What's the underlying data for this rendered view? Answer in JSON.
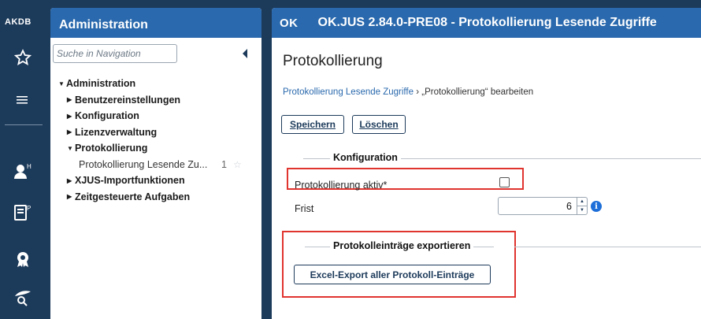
{
  "rail": {
    "logo": "AKDB",
    "icons": [
      "star-icon",
      "menu-icon",
      "user-h-icon",
      "form-p-icon",
      "badge-icon",
      "search-hand-icon"
    ]
  },
  "nav": {
    "header": "Administration",
    "search_placeholder": "Suche in Navigation",
    "tree": [
      {
        "label": "Administration",
        "level": 0,
        "caret": "▼"
      },
      {
        "label": "Benutzereinstellungen",
        "level": 1,
        "caret": "▶"
      },
      {
        "label": "Konfiguration",
        "level": 1,
        "caret": "▶"
      },
      {
        "label": "Lizenzverwaltung",
        "level": 1,
        "caret": "▶"
      },
      {
        "label": "Protokollierung",
        "level": 1,
        "caret": "▼"
      },
      {
        "label": "Protokollierung Lesende Zu...",
        "level": 2,
        "badge": "1"
      },
      {
        "label": "XJUS-Importfunktionen",
        "level": 1,
        "caret": "▶"
      },
      {
        "label": "Zeitgesteuerte Aufgaben",
        "level": 1,
        "caret": "▶"
      }
    ]
  },
  "main": {
    "logo": "OK",
    "header_title": "OK.JUS 2.84.0-PRE08 - Protokollierung Lesende Zugriffe",
    "page_title": "Protokollierung",
    "breadcrumb": {
      "link": "Protokollierung Lesende Zugriffe",
      "separator": " › ",
      "current": "„Protokollierung“ bearbeiten"
    },
    "buttons": {
      "save": "Speichern",
      "delete": "Löschen"
    },
    "section_config": "Konfiguration",
    "field_active_label": "Protokollierung aktiv*",
    "field_active_checked": false,
    "field_frist_label": "Frist",
    "field_frist_value": "6",
    "section_export": "Protokolleinträge exportieren",
    "export_button": "Excel-Export aller Protokoll-Einträge"
  },
  "colors": {
    "header_bg": "#2a69ad",
    "rail_bg": "#1c3a5a",
    "highlight": "#e0342f",
    "info": "#1d6ed8"
  }
}
